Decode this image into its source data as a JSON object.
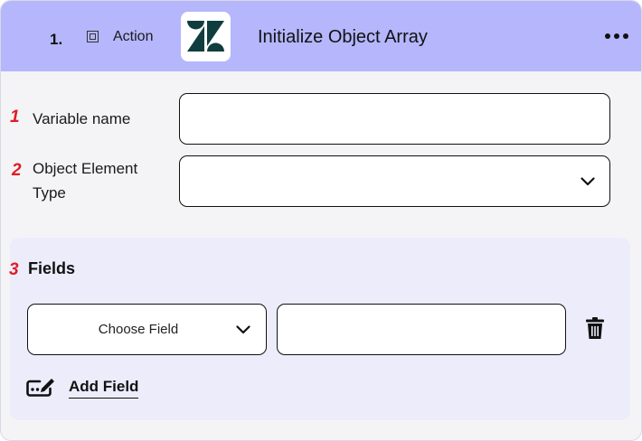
{
  "header": {
    "step_number": "1.",
    "action_label": "Action",
    "logo_icon": "zendesk-logo",
    "title": "Initialize Object Array",
    "menu_icon": "more-horizontal-icon",
    "background_color": "#b5b6fc"
  },
  "form": {
    "variable_name": {
      "marker": "1",
      "label": "Variable name",
      "value": ""
    },
    "object_element_type": {
      "marker": "2",
      "label_line1": "Object Element",
      "label_line2": "Type",
      "value": ""
    }
  },
  "fields_section": {
    "marker": "3",
    "title": "Fields",
    "rows": [
      {
        "field_select": "Choose Field",
        "value": ""
      }
    ],
    "delete_icon": "trash-icon",
    "add_icon": "edit-add-icon",
    "add_label": "Add Field"
  },
  "colors": {
    "marker": "#e01b24",
    "panel_background": "#ececfb"
  }
}
